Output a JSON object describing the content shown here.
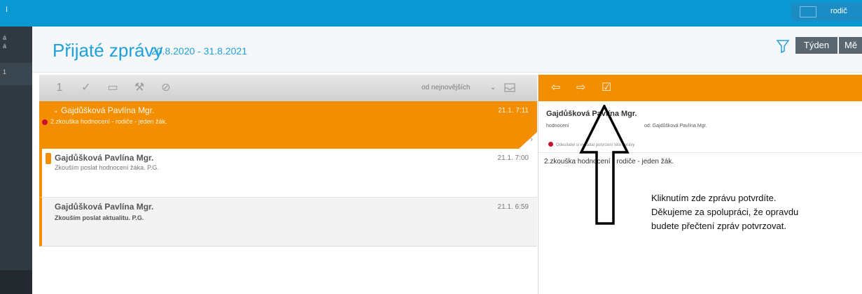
{
  "topbar": {
    "left_mark": "I",
    "role": "rodič"
  },
  "sidebar": {
    "text_top": "á\ná",
    "text_mid": "1"
  },
  "header": {
    "title": "Přijaté zprávy",
    "date_range": "20.8.2020 - 31.8.2021",
    "week_label": "Týden",
    "month_label": "Mě"
  },
  "toolbar": {
    "sort_label": "od nejnovějších",
    "sort_chevron": "⌄"
  },
  "messages": [
    {
      "sender": "Gajdůšková Pavlína Mgr.",
      "time": "21.1. 7:11",
      "subject": "2.zkouška hodnocení - rodiče - jeden žák.",
      "selected": true
    },
    {
      "sender": "Gajdůšková Pavlína Mgr.",
      "time": "21.1. 7:00",
      "subject": "Zkouším poslat hodnocení žáka. P.G."
    },
    {
      "sender": "Gajdůšková Pavlína Mgr.",
      "time": "21.1. 6:59",
      "subject": "Zkouším poslat aktualitu. P.G."
    }
  ],
  "detail": {
    "sender": "Gajdůšková Pavlína Mgr.",
    "type": "hodnocení",
    "from": "od: Gajdůšková Pavlína Mgr.",
    "warning": "Odesílatel si vyžádal potvrzení této zprávy",
    "subject": "2.zkouška hodnocení - rodiče - jeden žák."
  },
  "annotation": {
    "line1": "Kliknutím zde zprávu potvrdíte.",
    "line2": "Děkujeme za spolupráci, že opravdu",
    "line3": "budete přečtení zpráv potvrzovat."
  },
  "colors": {
    "brand_blue": "#0a98d3",
    "accent_orange": "#f28e00",
    "sidebar": "#2e3942"
  }
}
